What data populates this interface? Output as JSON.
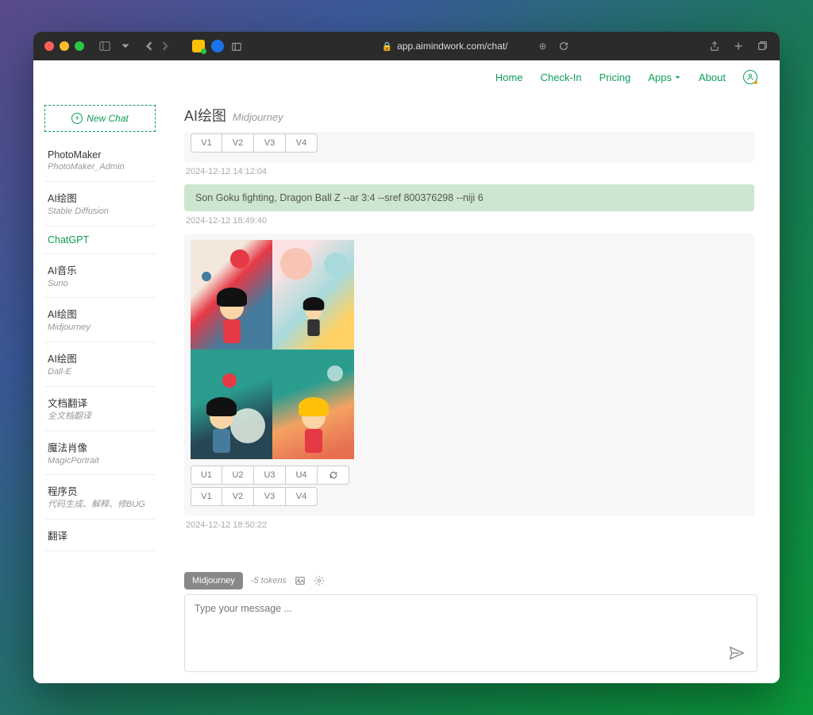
{
  "browser": {
    "url": "app.aimindwork.com/chat/"
  },
  "nav": {
    "home": "Home",
    "checkin": "Check-In",
    "pricing": "Pricing",
    "apps": "Apps",
    "about": "About"
  },
  "sidebar": {
    "new_chat": "New Chat",
    "items": [
      {
        "title": "PhotoMaker",
        "sub": "PhotoMaker_Admin"
      },
      {
        "title": "AI绘图",
        "sub": "Stable Diffusion"
      },
      {
        "title": "ChatGPT",
        "sub": "",
        "active": true
      },
      {
        "title": "AI音乐",
        "sub": "Suno"
      },
      {
        "title": "AI绘图",
        "sub": "Midjourney"
      },
      {
        "title": "AI绘图",
        "sub": "Dall-E"
      },
      {
        "title": "文档翻译",
        "sub": "全文档翻译"
      },
      {
        "title": "魔法肖像",
        "sub": "MagicPortrait"
      },
      {
        "title": "程序员",
        "sub": "代码生成、解释、修BUG"
      },
      {
        "title": "翻译",
        "sub": ""
      }
    ]
  },
  "chat": {
    "title": "AI绘图",
    "subtitle": "Midjourney",
    "partial_v": [
      "V1",
      "V2",
      "V3",
      "V4"
    ],
    "ts1": "2024-12-12 14:12:04",
    "prompt": "Son Goku fighting, Dragon Ball Z --ar 3:4 --sref 800376298 --niji 6",
    "ts2": "2024-12-12 18:49:40",
    "u_buttons": [
      "U1",
      "U2",
      "U3",
      "U4"
    ],
    "v_buttons": [
      "V1",
      "V2",
      "V3",
      "V4"
    ],
    "ts3": "2024-12-12 18:50:22"
  },
  "composer": {
    "model": "Midjourney",
    "tokens": "-5 tokens",
    "placeholder": "Type your message ..."
  }
}
